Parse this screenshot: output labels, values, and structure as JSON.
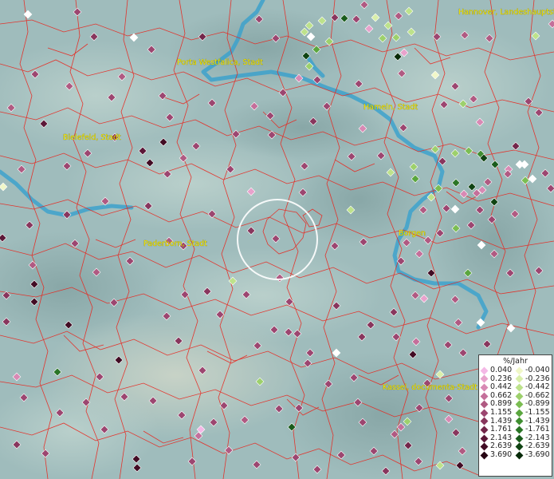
{
  "legend": {
    "title": "%/Jahr",
    "positive": [
      {
        "label": "0.040",
        "color": "#f4b8e6"
      },
      {
        "label": "0.236",
        "color": "#e8a2cc"
      },
      {
        "label": "0.442",
        "color": "#d889b4"
      },
      {
        "label": "0.662",
        "color": "#c46f9a"
      },
      {
        "label": "0.899",
        "color": "#b05a82"
      },
      {
        "label": "1.155",
        "color": "#9c4670"
      },
      {
        "label": "1.439",
        "color": "#88365d"
      },
      {
        "label": "1.761",
        "color": "#73264a"
      },
      {
        "label": "2.143",
        "color": "#5c1838"
      },
      {
        "label": "2.639",
        "color": "#420c24"
      },
      {
        "label": "3.690",
        "color": "#260412"
      }
    ],
    "negative": [
      {
        "label": "-0.040",
        "color": "#f0f7c8"
      },
      {
        "label": "-0.236",
        "color": "#d9efaa"
      },
      {
        "label": "-0.442",
        "color": "#bde28b"
      },
      {
        "label": "-0.662",
        "color": "#9dd06c"
      },
      {
        "label": "-0.899",
        "color": "#7bbd52"
      },
      {
        "label": "-1.155",
        "color": "#5aa63e"
      },
      {
        "label": "-1.439",
        "color": "#3f8e30"
      },
      {
        "label": "-1.761",
        "color": "#2a7526"
      },
      {
        "label": "-2.143",
        "color": "#1a5c1c"
      },
      {
        "label": "-2.639",
        "color": "#0f4312"
      },
      {
        "label": "-3.690",
        "color": "#062a08"
      }
    ]
  },
  "cities": [
    {
      "name": "Hannover, Landeshauptstadt"
    },
    {
      "name": "Porta Westfalica, Stadt"
    },
    {
      "name": "Hameln, Stadt"
    },
    {
      "name": "Bielefeld, Stadt"
    },
    {
      "name": "Paderborn, Stadt"
    },
    {
      "name": "Borgen"
    },
    {
      "name": "Kassel, documenta-Stadt"
    }
  ],
  "colors": {
    "terrain": "#9fbcbc",
    "borders": "#e8261e",
    "rivers": "#3da2cc",
    "labels": "#f4e600",
    "selection_circle": "#ffffff"
  }
}
